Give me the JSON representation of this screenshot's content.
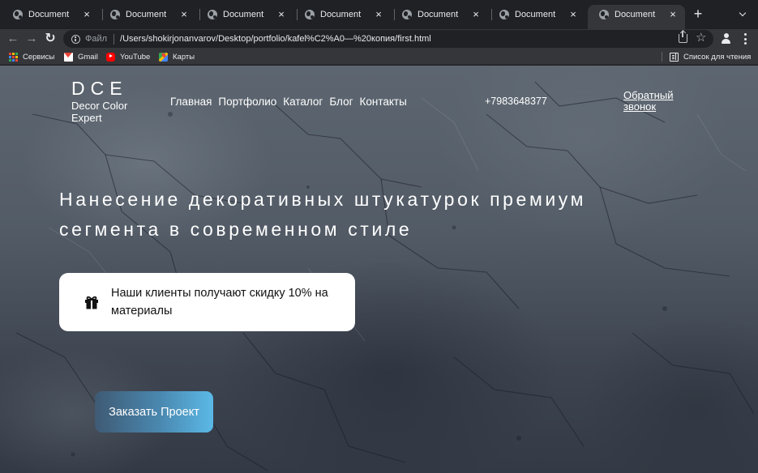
{
  "browser": {
    "tabs": [
      {
        "title": "Document",
        "active": false
      },
      {
        "title": "Document",
        "active": false
      },
      {
        "title": "Document",
        "active": false
      },
      {
        "title": "Document",
        "active": false
      },
      {
        "title": "Document",
        "active": false
      },
      {
        "title": "Document",
        "active": false
      },
      {
        "title": "Document",
        "active": true
      }
    ],
    "new_tab_label": "+",
    "address": {
      "scheme_label": "Файл",
      "url": "/Users/shokirjonanvarov/Desktop/portfolio/kafel%C2%A0—%20копия/first.html"
    },
    "bookmarks": [
      {
        "label": "Сервисы",
        "icon": "apps-grid-icon"
      },
      {
        "label": "Gmail",
        "icon": "gmail-icon"
      },
      {
        "label": "YouTube",
        "icon": "youtube-icon"
      },
      {
        "label": "Карты",
        "icon": "maps-icon"
      }
    ],
    "reading_list_label": "Список для чтения"
  },
  "site": {
    "logo": {
      "mark": "DCE",
      "subtitle": "Decor Color Expert"
    },
    "nav": [
      "Главная",
      "Портфолио",
      "Каталог",
      "Блог",
      "Контакты"
    ],
    "phone": "+7983648377",
    "callback_label": "Обратный звонок",
    "hero_title": "Нанесение декоративных штукатурок премиум сегмента в современном стиле",
    "promo_text": "Наши клиенты получают скидку 10% на материалы",
    "cta_label": "Заказать Проект",
    "colors": {
      "cta_start": "#3f5a74",
      "cta_end": "#5bb9e6",
      "background": "#525b66"
    }
  }
}
